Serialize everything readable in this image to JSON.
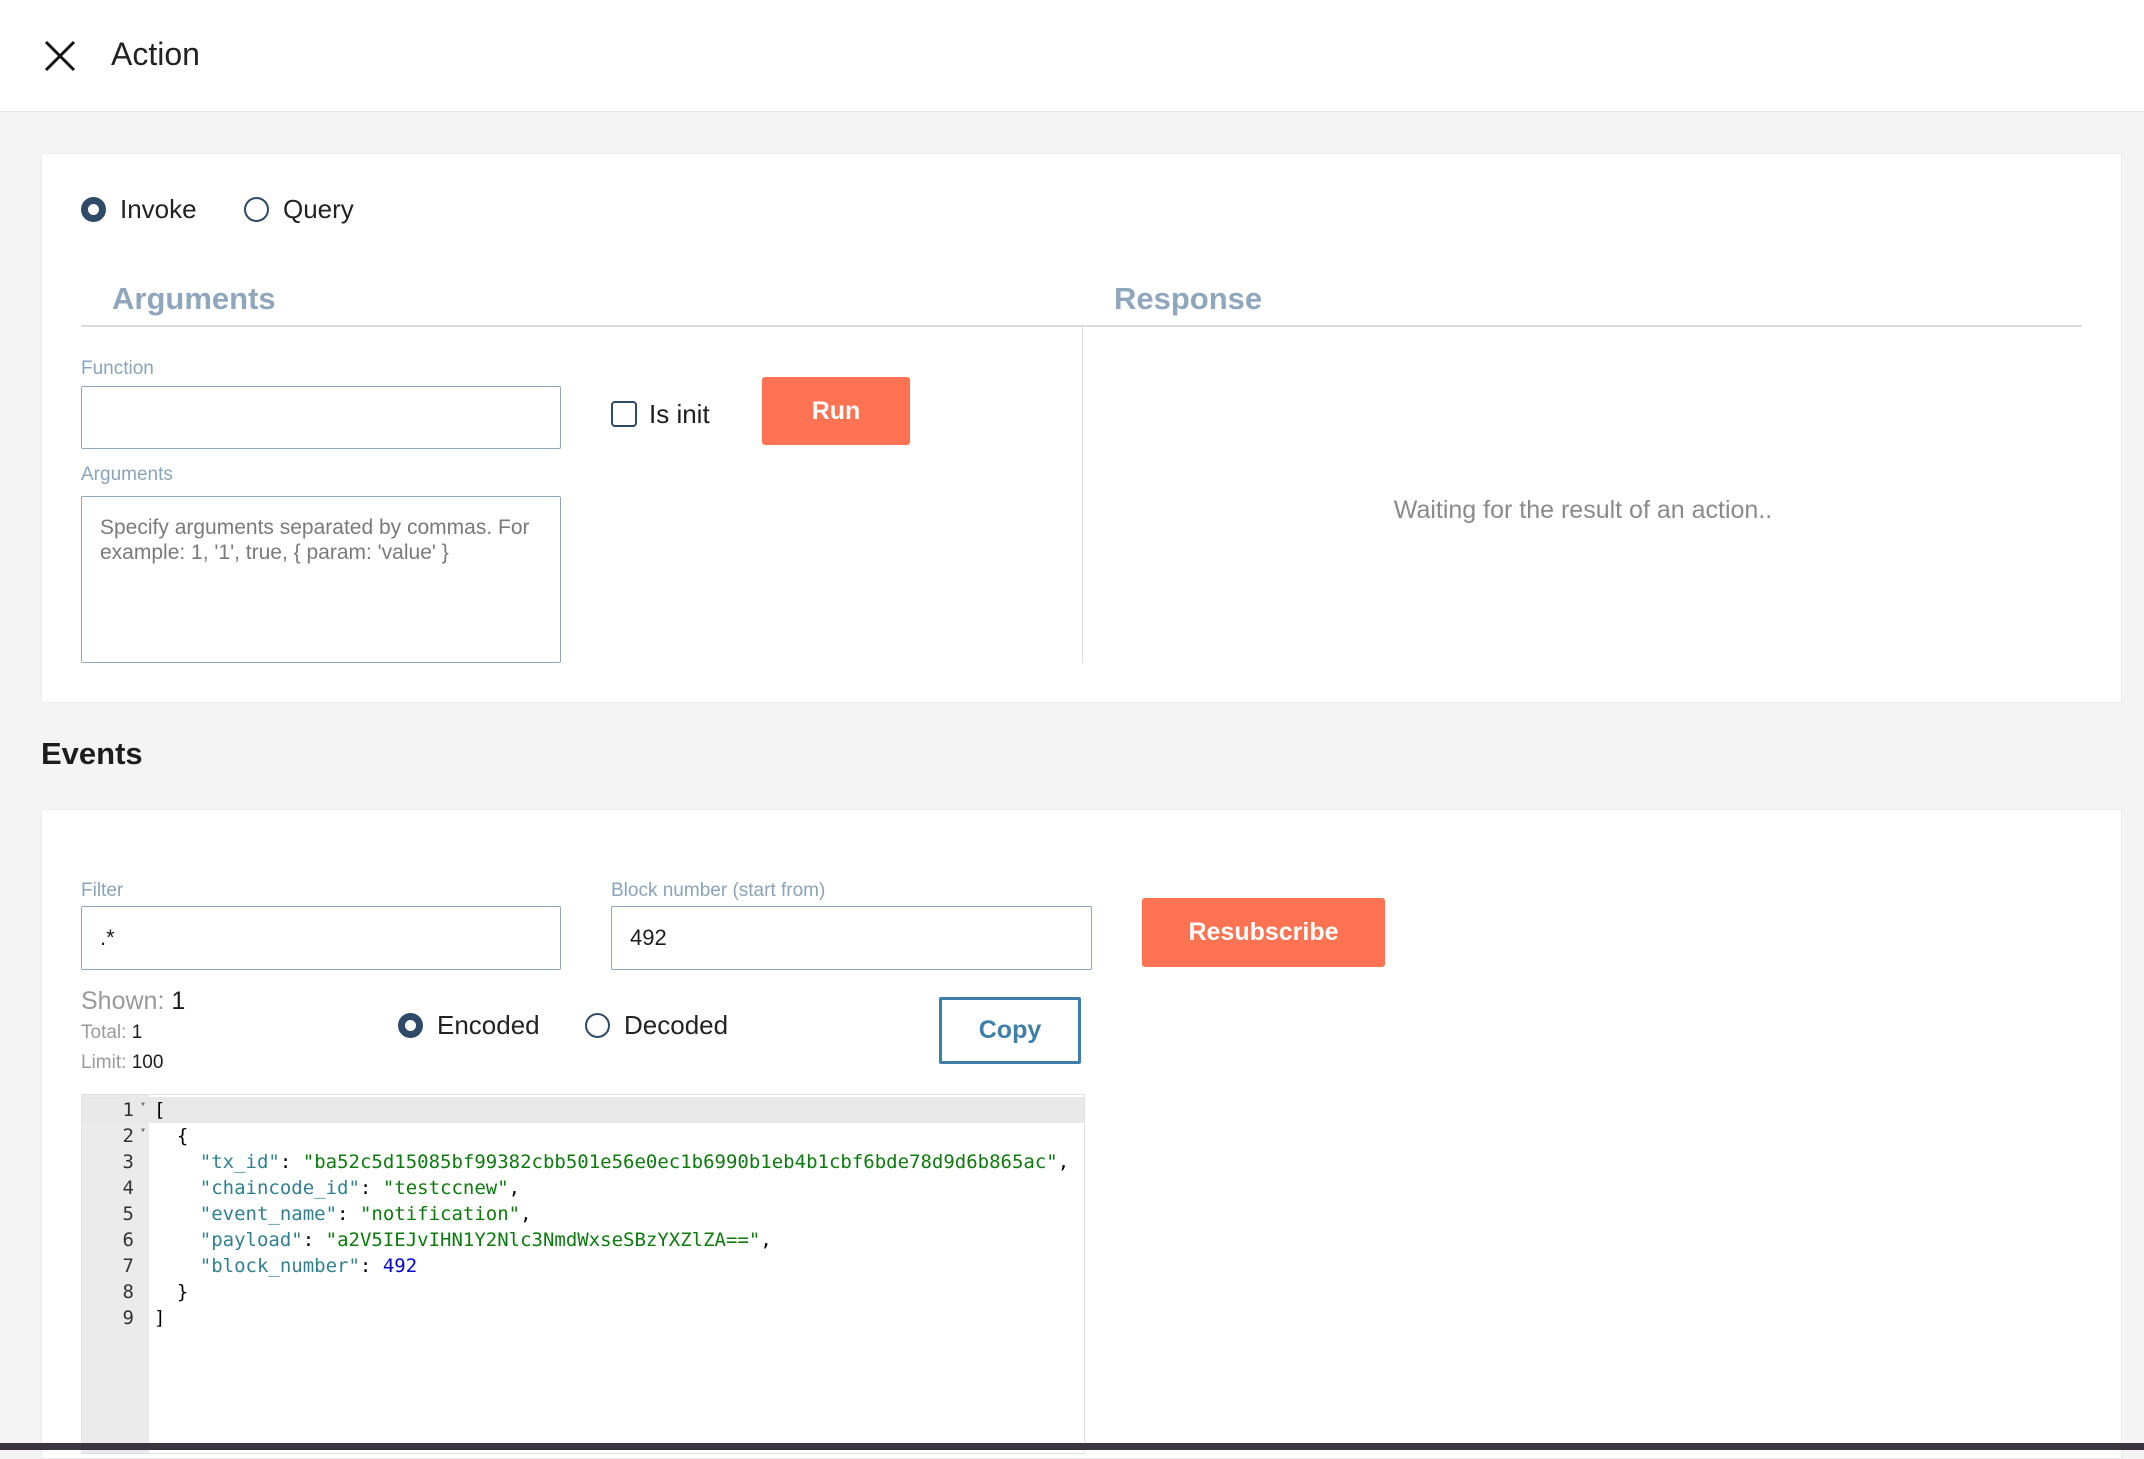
{
  "header": {
    "title": "Action",
    "close_icon": "close-icon"
  },
  "mode": {
    "options": [
      "Invoke",
      "Query"
    ],
    "selected": "Invoke"
  },
  "arguments_section": {
    "heading": "Arguments",
    "function_label": "Function",
    "function_value": "",
    "is_init_label": "Is init",
    "is_init_checked": false,
    "run_label": "Run",
    "arguments_label": "Arguments",
    "arguments_placeholder": "Specify arguments separated by commas. For example: 1, '1', true, { param: 'value' }"
  },
  "response_section": {
    "heading": "Response",
    "waiting_text": "Waiting for the result of an action.."
  },
  "events": {
    "heading": "Events",
    "filter_label": "Filter",
    "filter_value": ".*",
    "block_label": "Block number (start from)",
    "block_value": "492",
    "resubscribe_label": "Resubscribe",
    "shown_label": "Shown:",
    "shown_value": "1",
    "total_label": "Total:",
    "total_value": "1",
    "limit_label": "Limit:",
    "limit_value": "100",
    "format_options": [
      "Encoded",
      "Decoded"
    ],
    "format_selected": "Encoded",
    "copy_label": "Copy",
    "json": {
      "tx_id": "ba52c5d15085bf99382cbb501e56e0ec1b6990b1eb4b1cbf6bde78d9d6b865ac",
      "chaincode_id": "testccnew",
      "event_name": "notification",
      "payload": "a2V5IEJvIHN1Y2Nlc3NmdWxseSBzYXZlZA==",
      "block_number": "492"
    },
    "line_numbers": [
      "1",
      "2",
      "3",
      "4",
      "5",
      "6",
      "7",
      "8",
      "9"
    ]
  },
  "colors": {
    "accent": "#ff7352",
    "primary": "#2e4a66",
    "heading": "#8fa6bd"
  }
}
